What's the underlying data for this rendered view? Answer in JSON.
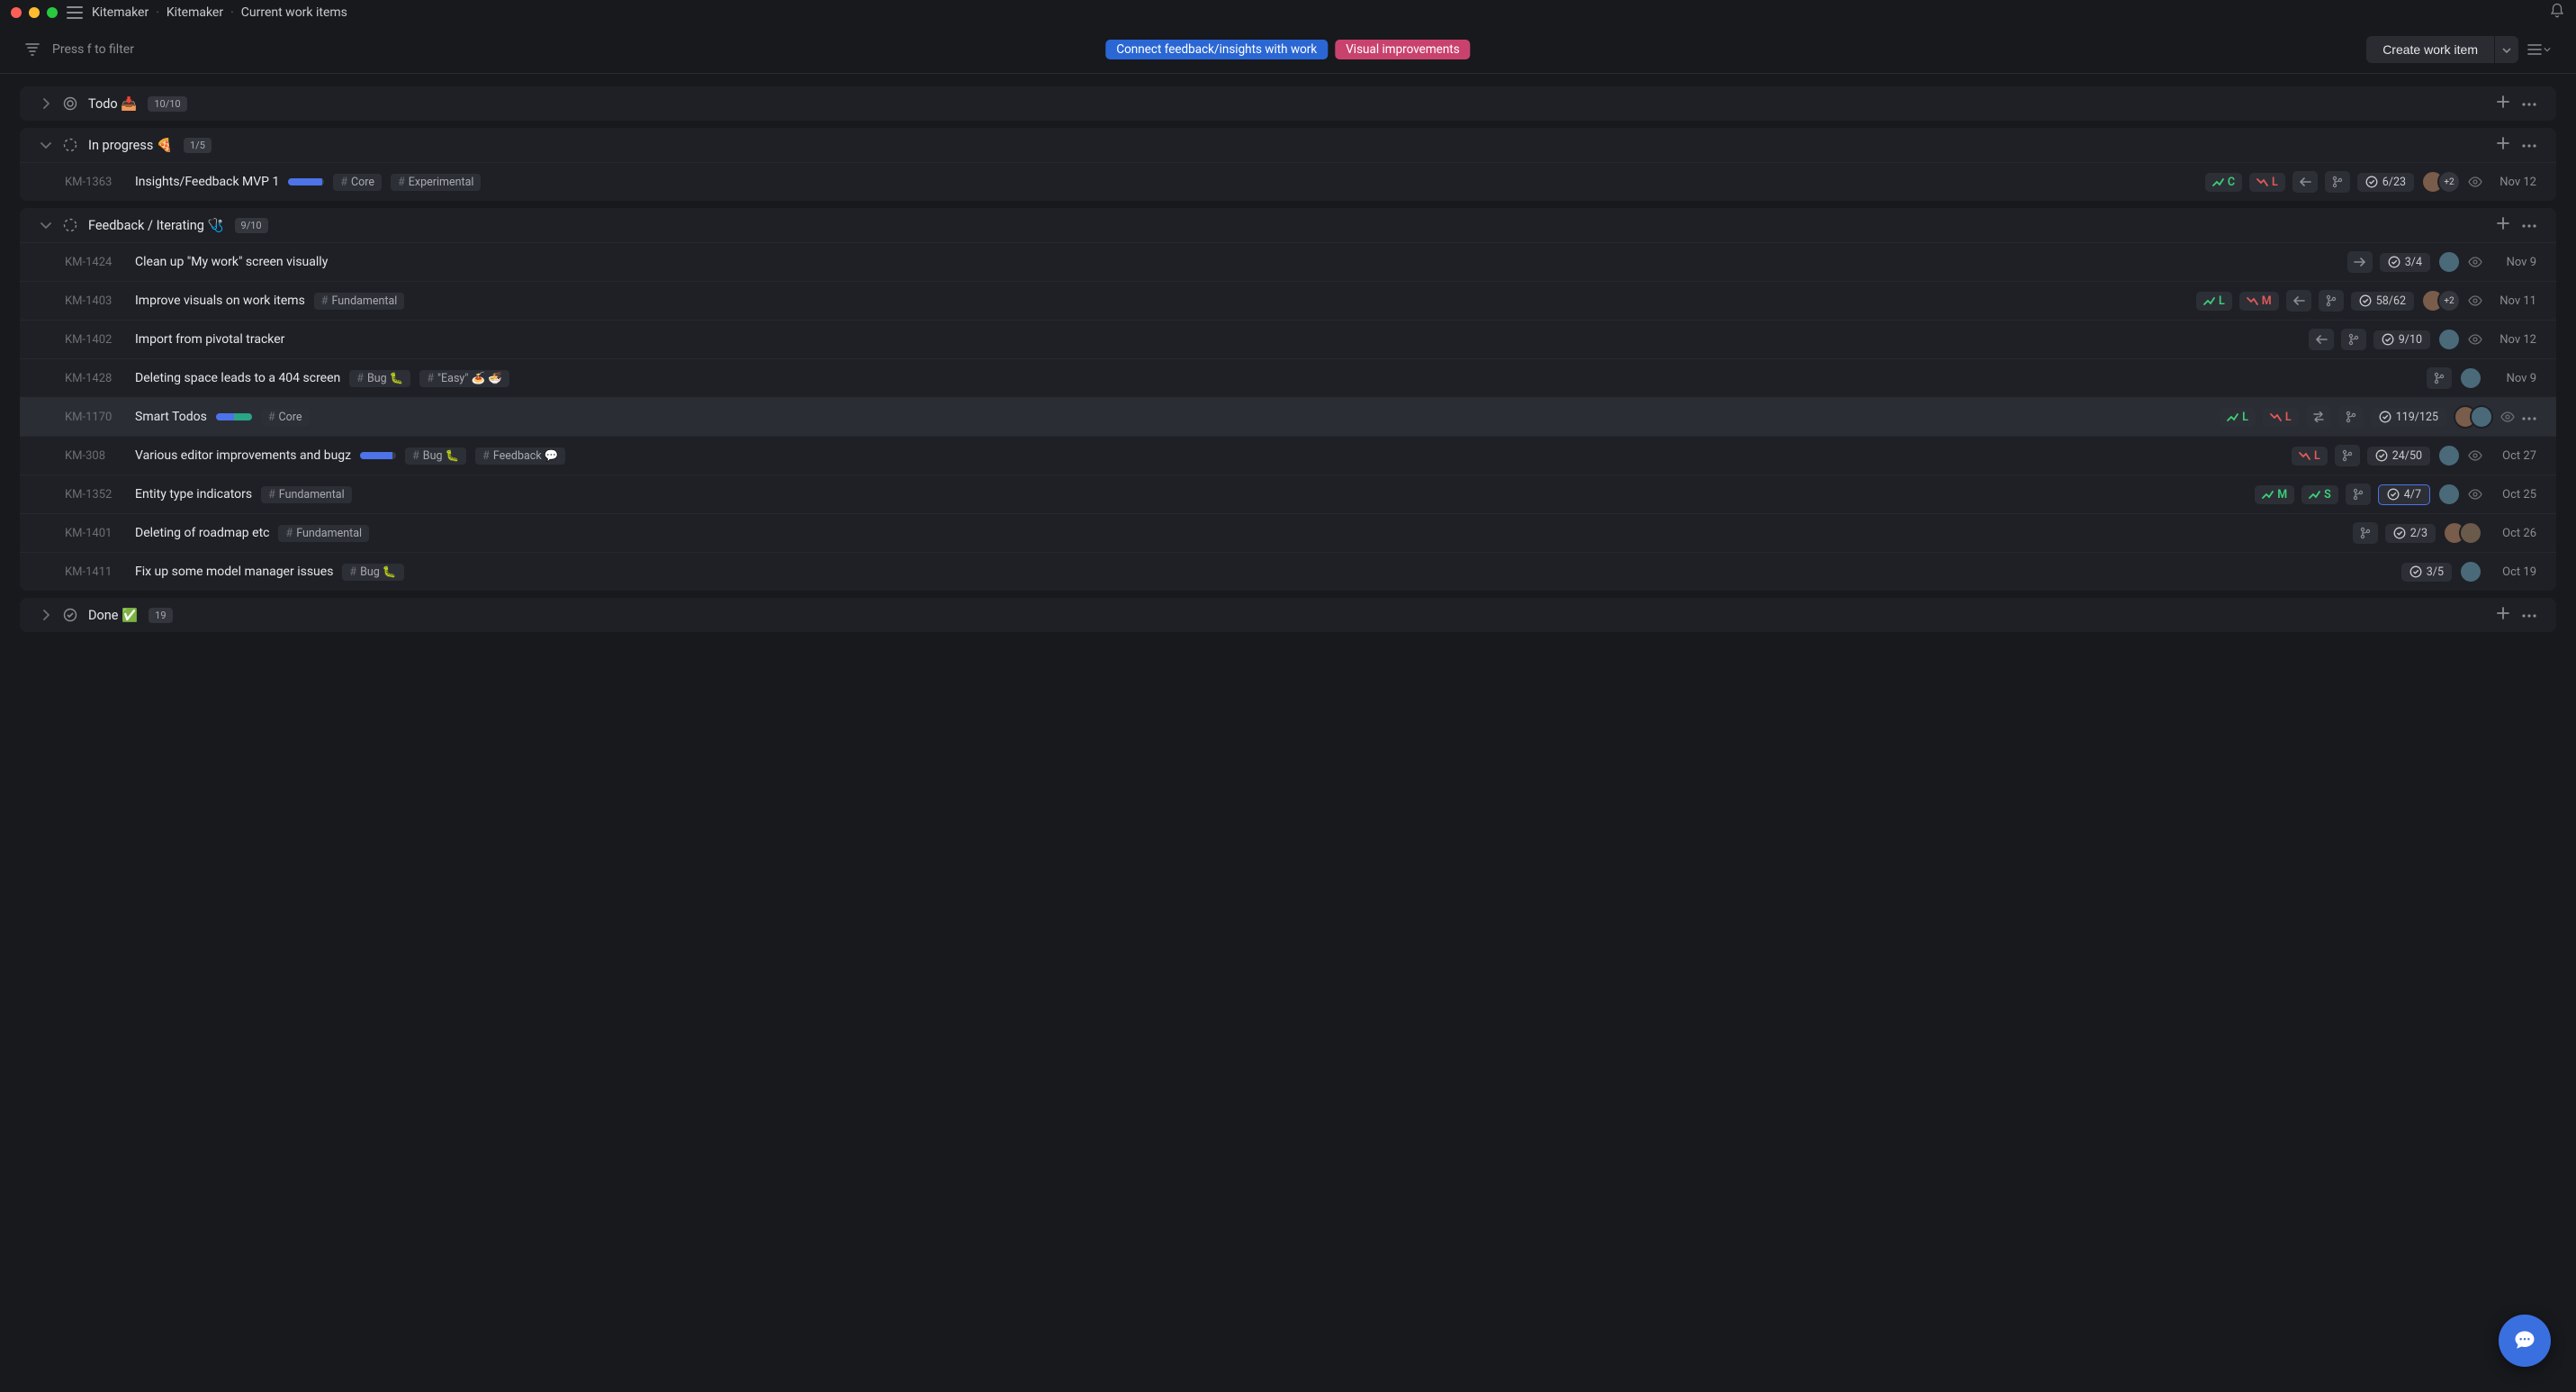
{
  "app": {
    "breadcrumb": [
      "Kitemaker",
      "Kitemaker",
      "Current work items"
    ]
  },
  "toolbar": {
    "filter_hint": "Press f to filter",
    "pills": [
      {
        "label": "Connect feedback/insights with work",
        "cls": "pill-blue"
      },
      {
        "label": "Visual improvements",
        "cls": "pill-pink"
      }
    ],
    "create_label": "Create work item"
  },
  "sections": [
    {
      "id": "todo",
      "icon": "target",
      "title": "Todo 📥",
      "count": "10/10",
      "collapsed": true,
      "rows": []
    },
    {
      "id": "inprogress",
      "icon": "progress",
      "title": "In progress 🍕",
      "count": "1/5",
      "collapsed": false,
      "rows": [
        {
          "id": "KM-1363",
          "title": "Insights/Feedback MVP 1",
          "progress": [
            {
              "cls": "pf-blue",
              "pct": 95
            }
          ],
          "tags": [
            "Core",
            "Experimental"
          ],
          "impact_effort": [
            {
              "kind": "impact",
              "dir": "up",
              "label": "C"
            },
            {
              "kind": "effort",
              "cls": "imp-down",
              "label": "L"
            }
          ],
          "chips": [
            "arrow-left",
            "branch"
          ],
          "todo": "6/23",
          "avatars": [
            "a1"
          ],
          "more_avatars": "+2",
          "watch": true,
          "date": "Nov 12"
        }
      ]
    },
    {
      "id": "feedback",
      "icon": "progress",
      "title": "Feedback / Iterating 🩺",
      "count": "9/10",
      "collapsed": false,
      "rows": [
        {
          "id": "KM-1424",
          "title": "Clean up \"My work\" screen visually",
          "tags": [],
          "chips": [
            "arrow-right"
          ],
          "todo": "3/4",
          "avatars": [
            "a2"
          ],
          "watch": true,
          "date": "Nov 9"
        },
        {
          "id": "KM-1403",
          "title": "Improve visuals on work items",
          "tags": [
            "Fundamental"
          ],
          "impact_effort": [
            {
              "kind": "impact",
              "dir": "up",
              "label": "L"
            },
            {
              "kind": "effort",
              "cls": "imp-down",
              "label": "M"
            }
          ],
          "chips": [
            "arrow-left",
            "branch"
          ],
          "todo": "58/62",
          "avatars": [
            "a1"
          ],
          "more_avatars": "+2",
          "watch": true,
          "date": "Nov 11"
        },
        {
          "id": "KM-1402",
          "title": "Import from pivotal tracker",
          "tags": [],
          "chips": [
            "arrow-left",
            "branch"
          ],
          "todo": "9/10",
          "avatars": [
            "a2"
          ],
          "watch": true,
          "date": "Nov 12"
        },
        {
          "id": "KM-1428",
          "title": "Deleting space leads to a 404 screen",
          "tags": [
            "Bug 🐛",
            "\"Easy\" 🍝 🍜"
          ],
          "chips": [
            "branch"
          ],
          "avatars": [
            "a2"
          ],
          "date": "Nov 9"
        },
        {
          "id": "KM-1170",
          "title": "Smart Todos",
          "selected": true,
          "progress": [
            {
              "cls": "pf-blue",
              "pct": 50
            },
            {
              "cls": "pf-teal",
              "pct": 50
            }
          ],
          "tags": [
            "Core"
          ],
          "impact_effort": [
            {
              "kind": "impact",
              "dir": "up",
              "label": "L"
            },
            {
              "kind": "effort",
              "cls": "imp-down",
              "label": "L"
            }
          ],
          "chips": [
            "swap",
            "branch"
          ],
          "todo": "119/125",
          "avatars": [
            "a1",
            "a2"
          ],
          "watch": true,
          "row_more": true
        },
        {
          "id": "KM-308",
          "title": "Various editor improvements and bugz",
          "progress": [
            {
              "cls": "pf-blue",
              "pct": 90
            }
          ],
          "tags": [
            "Bug 🐛",
            "Feedback 💬"
          ],
          "impact_effort": [
            {
              "kind": "effort",
              "cls": "imp-down",
              "label": "L"
            }
          ],
          "chips": [
            "branch"
          ],
          "todo": "24/50",
          "avatars": [
            "a2"
          ],
          "watch": true,
          "date": "Oct 27"
        },
        {
          "id": "KM-1352",
          "title": "Entity type indicators",
          "tags": [
            "Fundamental"
          ],
          "impact_effort": [
            {
              "kind": "impact",
              "dir": "up",
              "label": "M"
            },
            {
              "kind": "effort",
              "cls": "imp-up",
              "label": "S"
            }
          ],
          "chips": [
            "branch"
          ],
          "todo": "4/7",
          "todo_active": true,
          "avatars": [
            "a2"
          ],
          "watch": true,
          "date": "Oct 25"
        },
        {
          "id": "KM-1401",
          "title": "Deleting of roadmap etc",
          "tags": [
            "Fundamental"
          ],
          "chips": [
            "branch"
          ],
          "todo": "2/3",
          "avatars": [
            "a1",
            "a3"
          ],
          "date": "Oct 26"
        },
        {
          "id": "KM-1411",
          "title": "Fix up some model manager issues",
          "tags": [
            "Bug 🐛"
          ],
          "todo": "3/5",
          "avatars": [
            "a2"
          ],
          "date": "Oct 19"
        }
      ]
    },
    {
      "id": "done",
      "icon": "check",
      "title": "Done ✅",
      "count": "19",
      "collapsed": true,
      "rows": []
    }
  ]
}
